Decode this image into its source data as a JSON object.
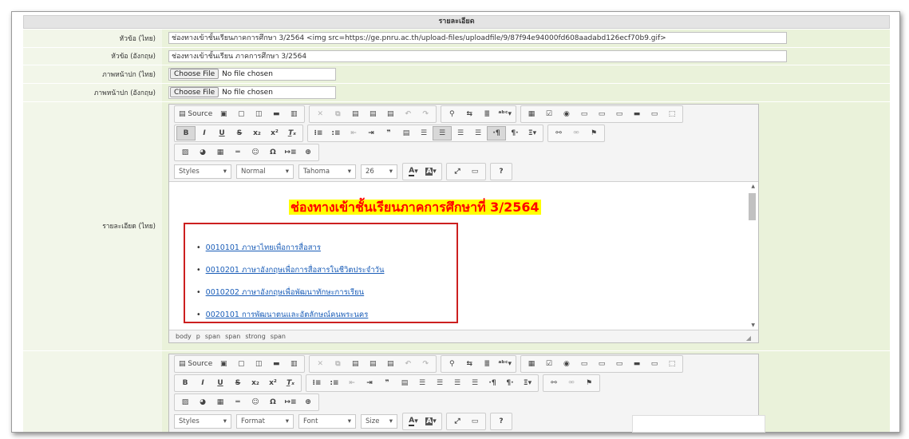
{
  "section_title": "รายละเอียด",
  "fields": {
    "title_th": {
      "label": "หัวข้อ (ไทย)",
      "value": "ช่องทางเข้าชั้นเรียนภาคการศึกษา 3/2564 <img src=https://ge.pnru.ac.th/upload-files/uploadfile/9/87f94e94000fd608aadabd126ecf70b9.gif>"
    },
    "title_en": {
      "label": "หัวข้อ (อังกฤษ)",
      "value": "ช่องทางเข้าชั้นเรียน ภาคการศึกษา 3/2564"
    },
    "cover_th": {
      "label": "ภาพหน้าปก (ไทย)",
      "button": "Choose File",
      "status": "No file chosen"
    },
    "cover_en": {
      "label": "ภาพหน้าปก (อังกฤษ)",
      "button": "Choose File",
      "status": "No file chosen"
    },
    "detail_th": {
      "label": "รายละเอียด (ไทย)"
    }
  },
  "toolbar": {
    "source_label": "Source",
    "styles": "Styles",
    "format": "Normal",
    "font": "Tahoma",
    "size": "26"
  },
  "toolbar2": {
    "styles": "Styles",
    "format": "Format",
    "font": "Font",
    "size": "Size"
  },
  "editor_content": {
    "heading": "ช่องทางเข้าชั้นเรียนภาคการศึกษาที่ 3/2564",
    "links": [
      "0010101 ภาษาไทยเพื่อการสื่อสาร",
      "0010201 ภาษาอังกฤษเพื่อการสื่อสารในชีวิตประจำวัน",
      "0010202 ภาษาอังกฤษเพื่อพัฒนาทักษะการเรียน",
      "0020101 การพัฒนาตนและอัตลักษณ์คนพระนคร"
    ]
  },
  "elements_path": [
    "body",
    "p",
    "span",
    "span",
    "strong",
    "span"
  ],
  "colors": {
    "label_bg": "#f2f6e9",
    "value_bg": "#eaf2da",
    "heading_red": "#ff0000",
    "heading_highlight": "#ffff00",
    "link": "#1a5db8",
    "box_border": "#cc1f1f"
  }
}
